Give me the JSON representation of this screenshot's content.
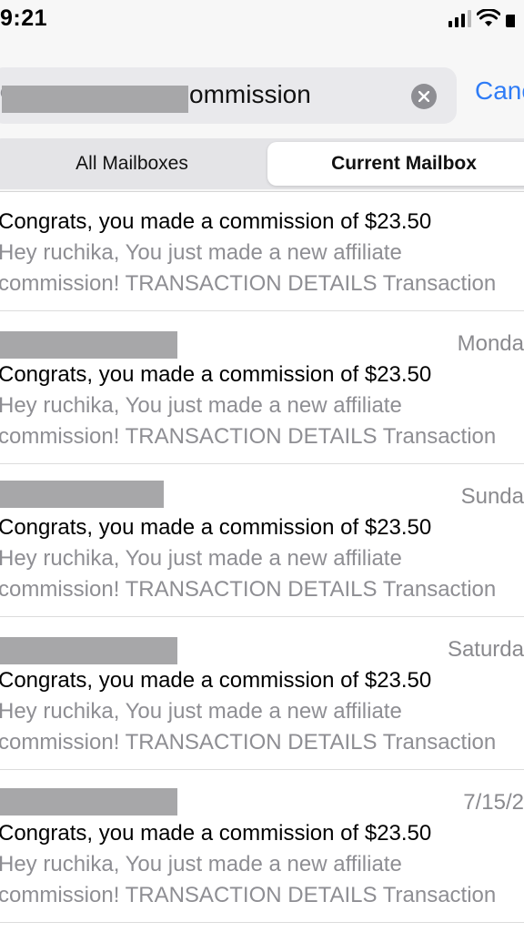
{
  "status_bar": {
    "time": "9:21"
  },
  "search": {
    "visible_query_suffix": "ommission"
  },
  "cancel_label": "Canc",
  "segments": {
    "all": "All Mailboxes",
    "current": "Current Mailbox"
  },
  "emails": [
    {
      "date": "",
      "subject": "Congrats, you made a commission of $23.50",
      "preview_line1": "Hey ruchika, You just made a new affiliate",
      "preview_line2": "commission! TRANSACTION DETAILS Transaction"
    },
    {
      "date": "Monda",
      "subject": "Congrats, you made a commission of $23.50",
      "preview_line1": "Hey ruchika, You just made a new affiliate",
      "preview_line2": "commission! TRANSACTION DETAILS Transaction"
    },
    {
      "date": "Sunda",
      "subject": "Congrats, you made a commission of $23.50",
      "preview_line1": "Hey ruchika, You just made a new affiliate",
      "preview_line2": "commission! TRANSACTION DETAILS Transaction"
    },
    {
      "date": "Saturda",
      "subject": "Congrats, you made a commission of $23.50",
      "preview_line1": "Hey ruchika, You just made a new affiliate",
      "preview_line2": "commission! TRANSACTION DETAILS Transaction"
    },
    {
      "date": "7/15/2",
      "subject": "Congrats, you made a commission of $23.50",
      "preview_line1": "Hey ruchika, You just made a new affiliate",
      "preview_line2": "commission! TRANSACTION DETAILS Transaction"
    }
  ]
}
